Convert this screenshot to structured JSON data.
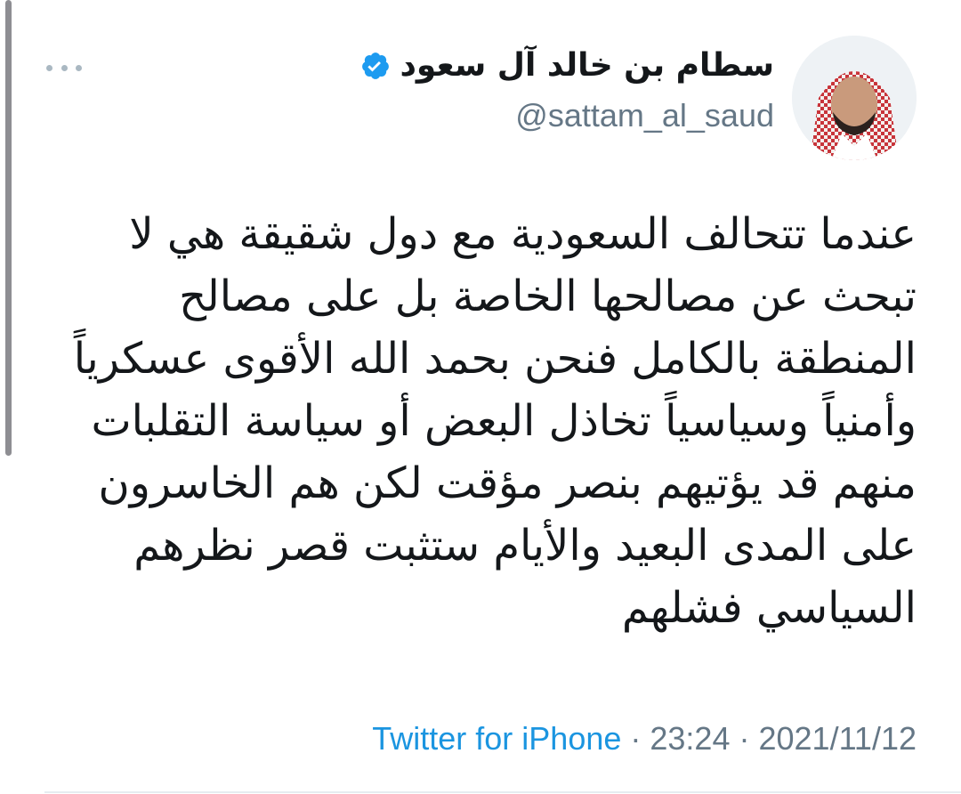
{
  "author": {
    "display_name": "سطام بن خالد آل سعود",
    "handle": "@sattam_al_saud",
    "verified": true
  },
  "tweet": {
    "lines": [
      "عندما تتحالف السعودية مع دول شقيقة هي لا",
      "تبحث عن مصالحها الخاصة بل على مصالح",
      "المنطقة بالكامل فنحن بحمد الله الأقوى عسكرياً",
      "وأمنياً وسياسياً تخاذل البعض أو سياسة التقلبات",
      "منهم قد يؤتيهم بنصر مؤقت لكن هم الخاسرون",
      "على المدى البعيد والأيام ستثبت قصر نظرهم",
      "السياسي فشلهم"
    ]
  },
  "meta": {
    "source": "Twitter for iPhone",
    "separator": " · ",
    "time": "23:24",
    "date": "2021/11/12"
  },
  "icons": {
    "more": "more-horizontal-icon",
    "verified": "verified-badge-icon"
  },
  "colors": {
    "accent": "#1b95e0",
    "verified": "#1d9bf0",
    "text": "#14171a",
    "muted": "#657786"
  }
}
